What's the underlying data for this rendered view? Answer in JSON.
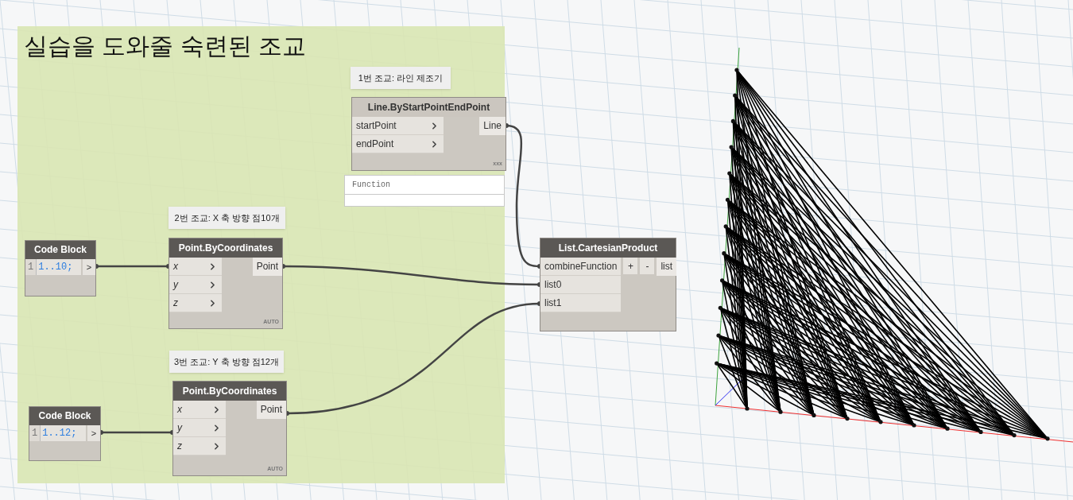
{
  "group": {
    "title": "실습을 도와줄 숙련된 조교"
  },
  "notes": [
    "1번 조교: 라인 제조기",
    "2번 조교: X 축 방향 점10개",
    "3번 조교: Y 축 방향 점12개"
  ],
  "nodes": [
    {
      "kind": "function",
      "title": "Line.ByStartPointEndPoint",
      "active": false,
      "italic_inputs": false,
      "inputs": [
        "startPoint",
        "endPoint"
      ],
      "outputs": [
        "Line"
      ],
      "lacing": "xxx",
      "preview": "Function"
    },
    {
      "kind": "code_block",
      "title": "Code Block",
      "line_number": "1",
      "code": "1..10;",
      "output": ">"
    },
    {
      "kind": "function",
      "title": "Point.ByCoordinates",
      "active": true,
      "italic_inputs": true,
      "inputs": [
        "x",
        "y",
        "z"
      ],
      "outputs": [
        "Point"
      ],
      "lacing": "AUTO"
    },
    {
      "kind": "code_block",
      "title": "Code Block",
      "line_number": "1",
      "code": "1..12;",
      "output": ">"
    },
    {
      "kind": "function",
      "title": "Point.ByCoordinates",
      "active": true,
      "italic_inputs": true,
      "inputs": [
        "x",
        "y",
        "z"
      ],
      "outputs": [
        "Point"
      ],
      "lacing": "AUTO"
    },
    {
      "kind": "variadic",
      "title": "List.CartesianProduct",
      "active": true,
      "italic_inputs": false,
      "inputs": [
        "combineFunction",
        "list0",
        "list1"
      ],
      "buttons": [
        "+",
        "-"
      ],
      "outputs": [
        "list"
      ]
    }
  ]
}
